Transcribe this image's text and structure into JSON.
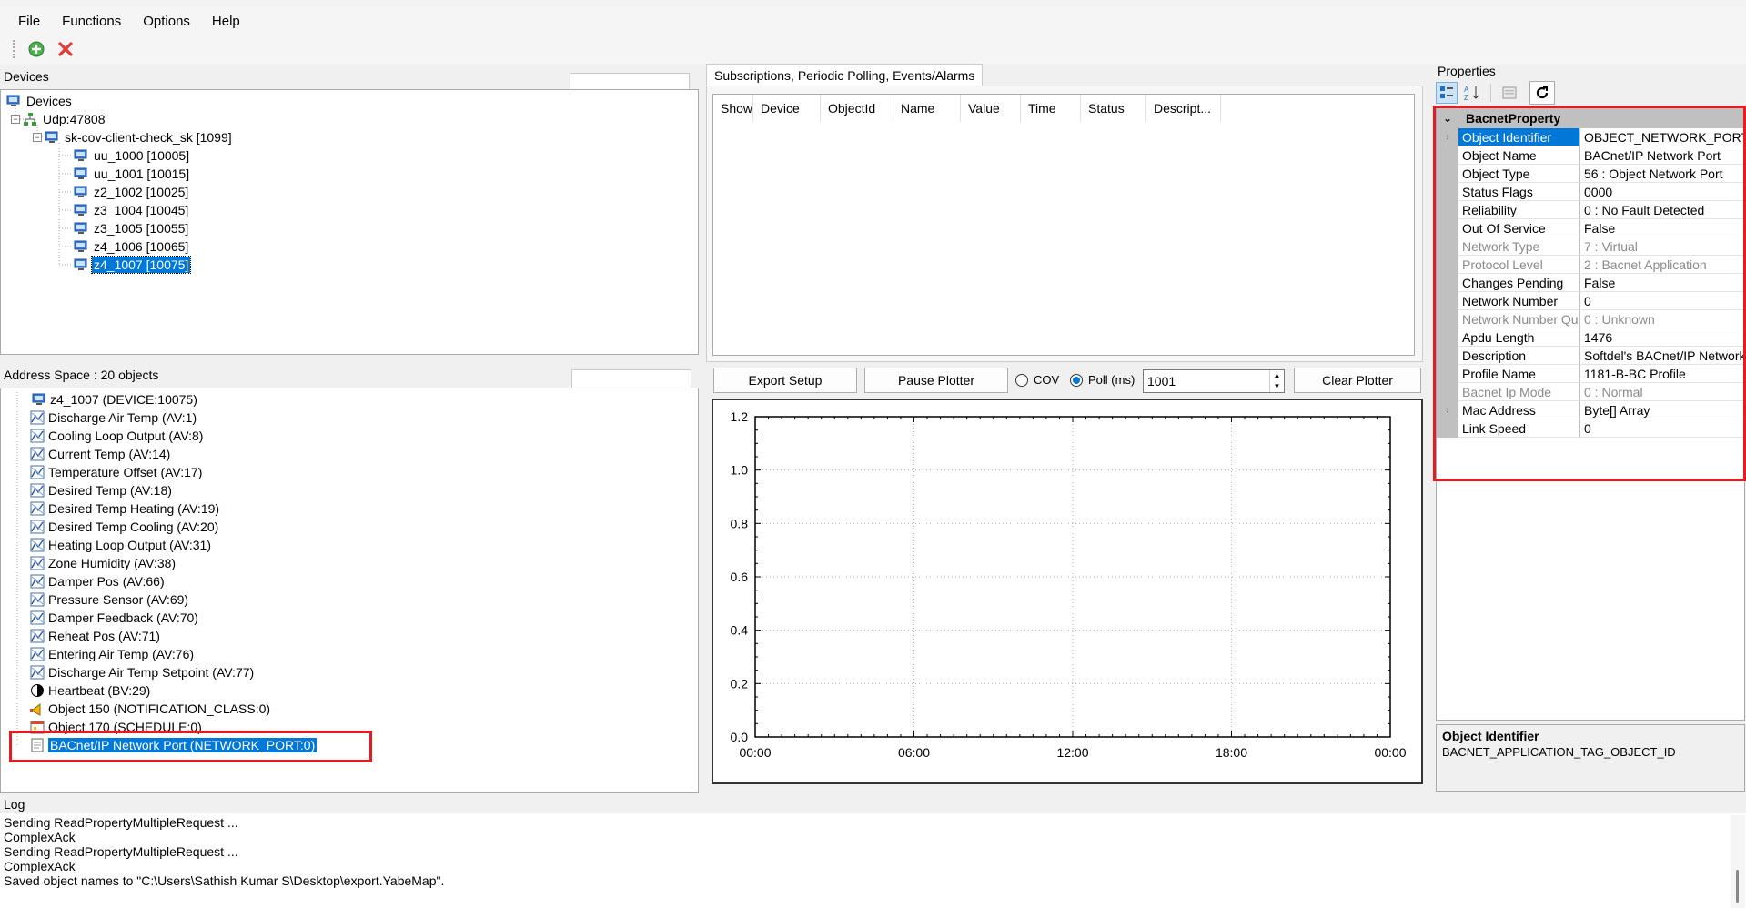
{
  "menu": [
    "File",
    "Functions",
    "Options",
    "Help"
  ],
  "devices": {
    "label": "Devices",
    "root": "Devices",
    "udp": "Udp:47808",
    "network": "sk-cov-client-check_sk [1099]",
    "items": [
      "uu_1000 [10005]",
      "uu_1001 [10015]",
      "z2_1002 [10025]",
      "z3_1004 [10045]",
      "z3_1005 [10055]",
      "z4_1006 [10065]",
      "z4_1007 [10075]"
    ],
    "selected_index": 6
  },
  "address_space": {
    "label": "Address Space : 20 objects",
    "items": [
      {
        "label": "z4_1007 (DEVICE:10075)",
        "icon": "device-icon"
      },
      {
        "label": "Discharge Air Temp (AV:1)",
        "icon": "analog-value-icon"
      },
      {
        "label": "Cooling Loop Output (AV:8)",
        "icon": "analog-value-icon"
      },
      {
        "label": "Current Temp (AV:14)",
        "icon": "analog-value-icon"
      },
      {
        "label": "Temperature Offset (AV:17)",
        "icon": "analog-value-icon"
      },
      {
        "label": "Desired Temp (AV:18)",
        "icon": "analog-value-icon"
      },
      {
        "label": "Desired Temp Heating (AV:19)",
        "icon": "analog-value-icon"
      },
      {
        "label": "Desired Temp Cooling (AV:20)",
        "icon": "analog-value-icon"
      },
      {
        "label": "Heating Loop Output (AV:31)",
        "icon": "analog-value-icon"
      },
      {
        "label": "Zone Humidity (AV:38)",
        "icon": "analog-value-icon"
      },
      {
        "label": "Damper Pos (AV:66)",
        "icon": "analog-value-icon"
      },
      {
        "label": "Pressure Sensor (AV:69)",
        "icon": "analog-value-icon"
      },
      {
        "label": "Damper Feedback (AV:70)",
        "icon": "analog-value-icon"
      },
      {
        "label": "Reheat Pos (AV:71)",
        "icon": "analog-value-icon"
      },
      {
        "label": "Entering Air Temp (AV:76)",
        "icon": "analog-value-icon"
      },
      {
        "label": "Discharge Air Temp Setpoint (AV:77)",
        "icon": "analog-value-icon"
      },
      {
        "label": "Heartbeat (BV:29)",
        "icon": "binary-value-icon"
      },
      {
        "label": "Object 150 (NOTIFICATION_CLASS:0)",
        "icon": "notification-icon"
      },
      {
        "label": "Object 170 (SCHEDULE:0)",
        "icon": "schedule-icon"
      },
      {
        "label": "BACnet/IP Network Port (NETWORK_PORT:0)",
        "icon": "network-port-icon"
      }
    ],
    "selected_index": 19
  },
  "subscriptions": {
    "tab": "Subscriptions, Periodic Polling, Events/Alarms",
    "columns": [
      "Show",
      "Device",
      "ObjectId",
      "Name",
      "Value",
      "Time",
      "Status",
      "Descript..."
    ]
  },
  "plotter": {
    "export_label": "Export Setup",
    "pause_label": "Pause Plotter",
    "cov_label": "COV",
    "poll_label": "Poll (ms)",
    "poll_value": "1001",
    "clear_label": "Clear Plotter",
    "mode": "poll"
  },
  "chart_data": {
    "type": "line",
    "title": "",
    "xlabel": "",
    "ylabel": "",
    "x_ticks": [
      "00:00",
      "06:00",
      "12:00",
      "18:00",
      "00:00"
    ],
    "y_ticks": [
      "0.0",
      "0.2",
      "0.4",
      "0.6",
      "0.8",
      "1.0",
      "1.2"
    ],
    "ylim": [
      0,
      1.2
    ],
    "grid": true,
    "series": []
  },
  "properties": {
    "label": "Properties",
    "category": "BacnetProperty",
    "rows": [
      {
        "name": "Object Identifier",
        "value": "OBJECT_NETWORK_PORT",
        "readonly": false,
        "expandable": true
      },
      {
        "name": "Object Name",
        "value": "BACnet/IP Network Port",
        "readonly": false,
        "expandable": false
      },
      {
        "name": "Object Type",
        "value": "56 : Object Network Port",
        "readonly": false,
        "expandable": false
      },
      {
        "name": "Status Flags",
        "value": "0000",
        "readonly": false,
        "expandable": false
      },
      {
        "name": "Reliability",
        "value": "0 : No Fault Detected",
        "readonly": false,
        "expandable": false
      },
      {
        "name": "Out Of Service",
        "value": "False",
        "readonly": false,
        "expandable": false
      },
      {
        "name": "Network Type",
        "value": "7 : Virtual",
        "readonly": true,
        "expandable": false
      },
      {
        "name": "Protocol Level",
        "value": "2 : Bacnet Application",
        "readonly": true,
        "expandable": false
      },
      {
        "name": "Changes Pending",
        "value": "False",
        "readonly": false,
        "expandable": false
      },
      {
        "name": "Network Number",
        "value": "0",
        "readonly": false,
        "expandable": false
      },
      {
        "name": "Network Number Qua",
        "value": "0 : Unknown",
        "readonly": true,
        "expandable": false
      },
      {
        "name": "Apdu Length",
        "value": "1476",
        "readonly": false,
        "expandable": false
      },
      {
        "name": "Description",
        "value": "Softdel's BACnet/IP Network",
        "readonly": false,
        "expandable": false
      },
      {
        "name": "Profile Name",
        "value": "1181-B-BC Profile",
        "readonly": false,
        "expandable": false
      },
      {
        "name": "Bacnet Ip Mode",
        "value": "0 : Normal",
        "readonly": true,
        "expandable": false
      },
      {
        "name": "Mac Address",
        "value": "Byte[] Array",
        "readonly": false,
        "expandable": true
      },
      {
        "name": "Link Speed",
        "value": "0",
        "readonly": false,
        "expandable": false
      }
    ],
    "selected_index": 0,
    "desc_title": "Object Identifier",
    "desc_text": "BACNET_APPLICATION_TAG_OBJECT_ID"
  },
  "log": {
    "label": "Log",
    "lines": [
      "Sending ReadPropertyMultipleRequest ...",
      "ComplexAck",
      "Sending ReadPropertyMultipleRequest ...",
      "ComplexAck",
      "Saved object names to \"C:\\Users\\Sathish Kumar S\\Desktop\\export.YabeMap\"."
    ]
  },
  "colors": {
    "selection": "#0078d7",
    "highlight_box": "#e31b23",
    "category_gray": "#c0c0c0"
  }
}
